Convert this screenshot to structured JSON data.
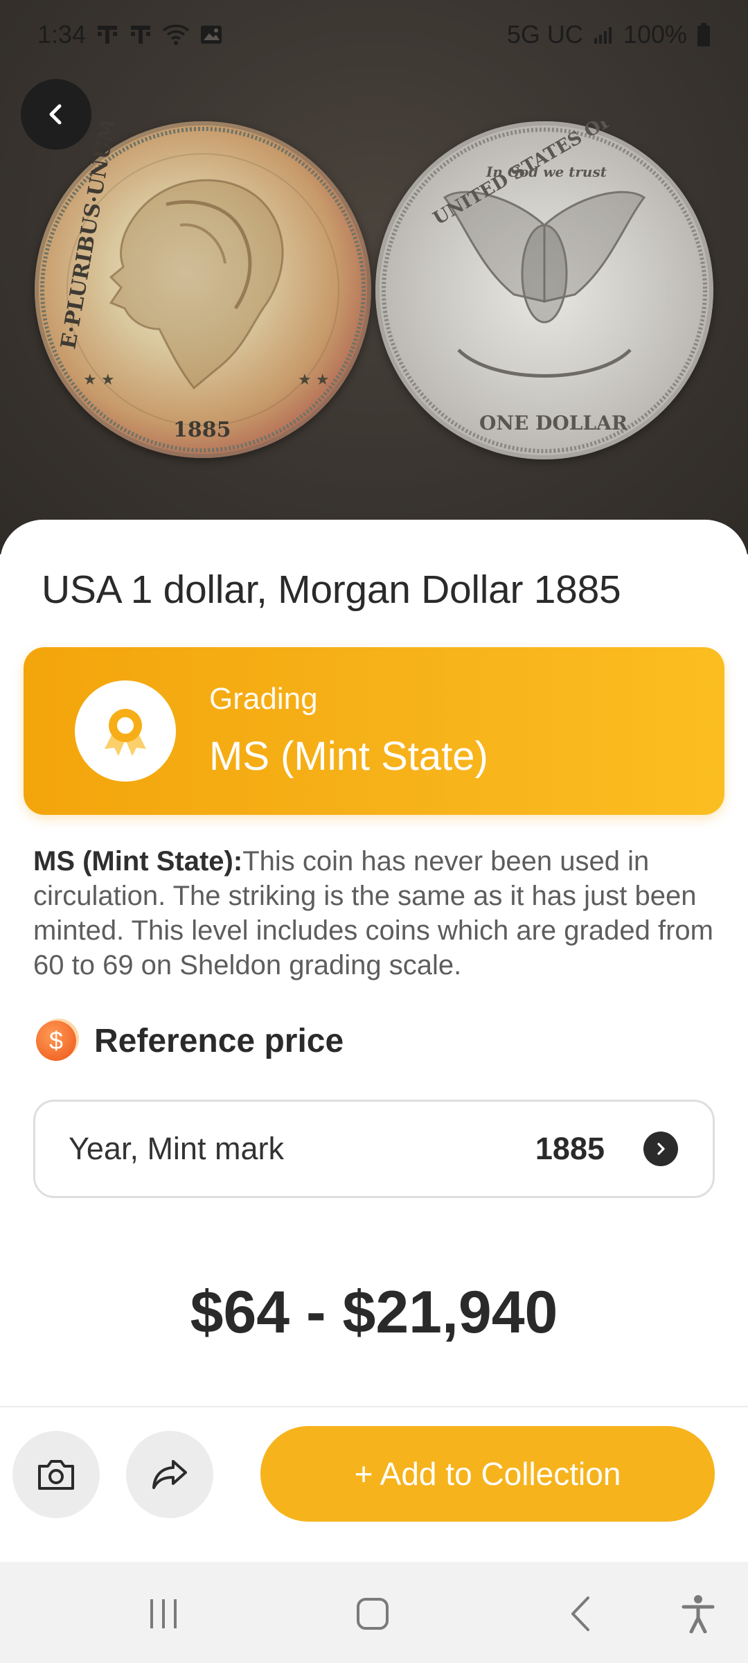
{
  "status_bar": {
    "time": "1:34",
    "network": "5G UC",
    "battery": "100%"
  },
  "coin": {
    "title": "USA 1 dollar, Morgan Dollar 1885",
    "obverse_legend": "E·PLURIBUS·UNUM",
    "obverse_year": "1885",
    "reverse_legend_top": "UNITED STATES OF AMERICA",
    "reverse_motto": "In God we trust",
    "reverse_denomination": "ONE DOLLAR"
  },
  "grading": {
    "label": "Grading",
    "value": "MS (Mint State)"
  },
  "description": {
    "term": "MS (Mint State):",
    "text": "This coin has never been used in circulation. The striking is the same as it has just been minted. This level includes coins which are graded from 60 to 69 on Sheldon grading scale."
  },
  "reference": {
    "icon_symbol": "$",
    "title": "Reference price",
    "selector_label": "Year, Mint mark",
    "selector_value": "1885",
    "price_range": "$64 - $21,940"
  },
  "actions": {
    "add_label": "+ Add to Collection"
  },
  "icons": {
    "back": "back-arrow-icon",
    "camera": "camera-icon",
    "share": "share-icon",
    "award": "award-ribbon-icon",
    "coin": "dollar-coin-icon",
    "chevron": "chevron-right-icon"
  },
  "colors": {
    "accent": "#f6b31c",
    "grade_gradient_start": "#f3a50b",
    "grade_gradient_end": "#fbbe20",
    "ref_icon": "#f26a2a"
  }
}
